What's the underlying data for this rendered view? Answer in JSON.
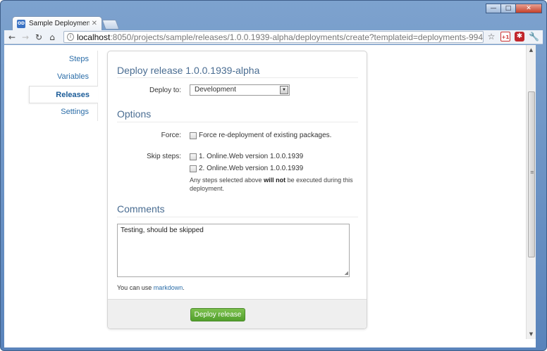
{
  "window": {
    "controls": {
      "minimize": "—",
      "maximize": "□",
      "close": "✕"
    }
  },
  "tab": {
    "icon_text": "OD",
    "title": "Sample Deployments - Octo",
    "close": "✕"
  },
  "toolbar": {
    "url_host": "localhost",
    "url_rest": ":8050/projects/sample/releases/1.0.0.1939-alpha/deployments/create?templateid=deployments-994",
    "gplus_text": "+1"
  },
  "sidebar": {
    "items": [
      {
        "label": "Steps"
      },
      {
        "label": "Variables"
      },
      {
        "label": "Releases"
      },
      {
        "label": "Settings"
      }
    ]
  },
  "form": {
    "title": "Deploy release 1.0.0.1939-alpha",
    "deploy_to_label": "Deploy to:",
    "deploy_to_value": "Development",
    "options_heading": "Options",
    "force_label": "Force:",
    "force_text": "Force re-deployment of existing packages.",
    "skip_label": "Skip steps:",
    "steps": [
      {
        "label": "1. Online.Web version 1.0.0.1939"
      },
      {
        "label": "2. Online.Web version 1.0.0.1939"
      }
    ],
    "note_prefix": "Any steps selected above ",
    "note_bold": "will not",
    "note_suffix": " be executed during this deployment.",
    "comments_heading": "Comments",
    "comments_value": "Testing, should be skipped",
    "help_prefix": "You can use ",
    "help_link": "markdown",
    "help_suffix": ".",
    "deploy_button": "Deploy release"
  }
}
